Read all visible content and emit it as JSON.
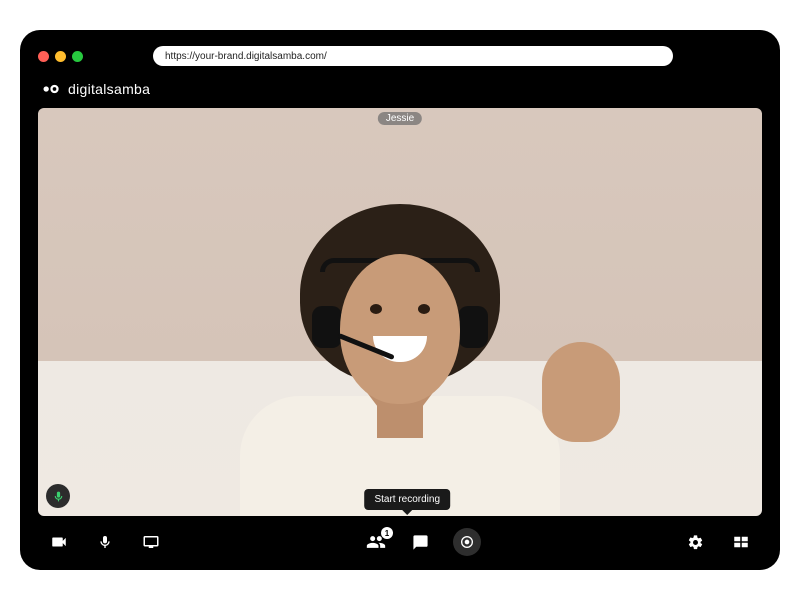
{
  "browser": {
    "url": "https://your-brand.digitalsamba.com/"
  },
  "brand": {
    "name": "digitalsamba"
  },
  "participant": {
    "name": "Jessie"
  },
  "tooltip": {
    "record": "Start recording"
  },
  "toolbar": {
    "participants_badge": "1"
  }
}
